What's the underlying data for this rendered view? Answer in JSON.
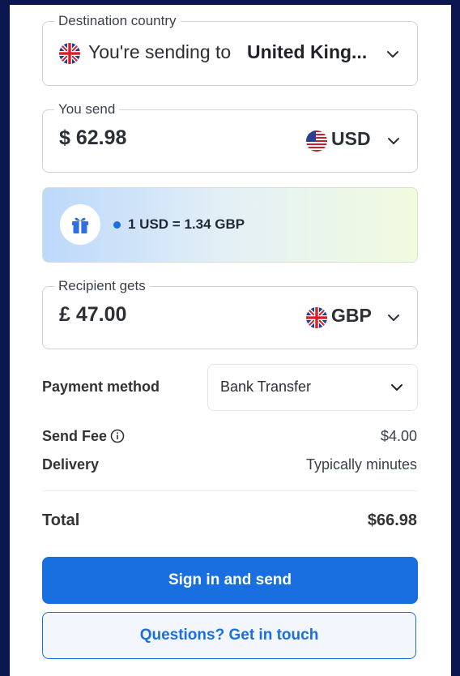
{
  "destination": {
    "legend": "Destination country",
    "prefix": "You're sending to",
    "country": "United King...",
    "flag_icon": "uk-flag-icon"
  },
  "send": {
    "legend": "You send",
    "amount": "$ 62.98",
    "currency": "USD",
    "flag_icon": "us-flag-icon"
  },
  "rate": {
    "text": "1 USD = 1.34 GBP",
    "icon": "gift-icon"
  },
  "receive": {
    "legend": "Recipient gets",
    "amount": "£ 47.00",
    "currency": "GBP",
    "flag_icon": "uk-flag-icon"
  },
  "payment": {
    "label": "Payment method",
    "value": "Bank Transfer"
  },
  "fees": {
    "send_fee_label": "Send Fee",
    "send_fee_value": "$4.00",
    "delivery_label": "Delivery",
    "delivery_value": "Typically minutes"
  },
  "total": {
    "label": "Total",
    "value": "$66.98"
  },
  "buttons": {
    "primary": "Sign in and send",
    "secondary": "Questions? Get in touch"
  },
  "colors": {
    "page_bg": "#0b1650",
    "accent": "#1a6fe0",
    "card_bg": "#ffffff"
  }
}
